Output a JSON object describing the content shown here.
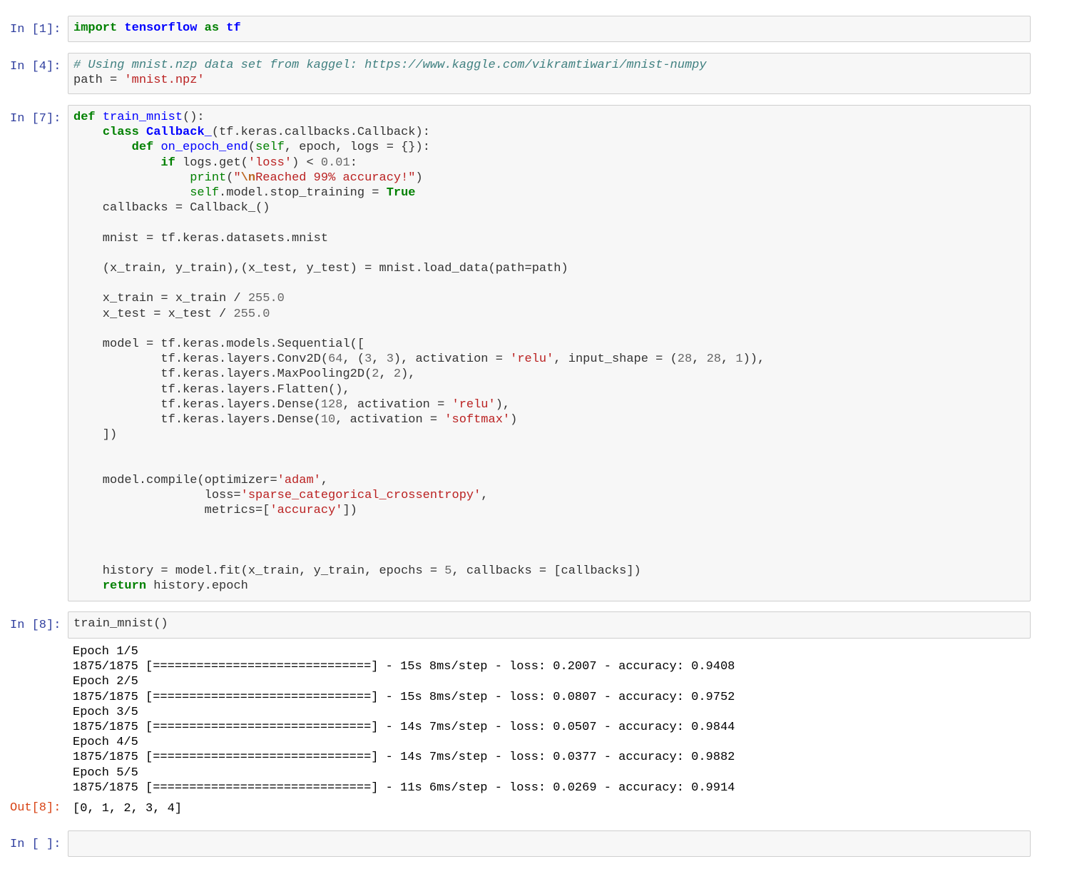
{
  "cells": [
    {
      "prompt": "In [1]:",
      "lines": [
        [
          [
            "kw",
            "import"
          ],
          [
            "",
            ""
          ],
          [
            "t",
            " "
          ],
          [
            "ns",
            "tensorflow"
          ],
          [
            "t",
            " "
          ],
          [
            "kw",
            "as"
          ],
          [
            "t",
            " "
          ],
          [
            "ns",
            "tf"
          ]
        ]
      ]
    },
    {
      "prompt": "In [4]:",
      "lines": [
        [
          [
            "cm",
            "# Using mnist.nzp data set from kaggel: https://www.kaggle.com/vikramtiwari/mnist-numpy"
          ]
        ],
        [
          [
            "t",
            "path = "
          ],
          [
            "st",
            "'mnist.npz'"
          ]
        ]
      ]
    },
    {
      "prompt": "In [7]:",
      "lines": [
        [
          [
            "kw",
            "def"
          ],
          [
            "t",
            " "
          ],
          [
            "fn",
            "train_mnist"
          ],
          [
            "t",
            "():"
          ]
        ],
        [
          [
            "t",
            "    "
          ],
          [
            "kw",
            "class"
          ],
          [
            "t",
            " "
          ],
          [
            "ns",
            "Callback_"
          ],
          [
            "t",
            "(tf.keras.callbacks.Callback):"
          ]
        ],
        [
          [
            "t",
            "        "
          ],
          [
            "kw",
            "def"
          ],
          [
            "t",
            " "
          ],
          [
            "fn",
            "on_epoch_end"
          ],
          [
            "t",
            "("
          ],
          [
            "nb",
            "self"
          ],
          [
            "t",
            ", epoch, logs = {}):"
          ]
        ],
        [
          [
            "t",
            "            "
          ],
          [
            "kw",
            "if"
          ],
          [
            "t",
            " logs.get("
          ],
          [
            "st",
            "'loss'"
          ],
          [
            "t",
            ") < "
          ],
          [
            "nm",
            "0.01"
          ],
          [
            "t",
            ":"
          ]
        ],
        [
          [
            "t",
            "                "
          ],
          [
            "nb",
            "print"
          ],
          [
            "t",
            "("
          ],
          [
            "st",
            "\""
          ],
          [
            "es",
            "\\n"
          ],
          [
            "st",
            "Reached 99% accuracy!\""
          ],
          [
            "t",
            ")"
          ]
        ],
        [
          [
            "t",
            "                "
          ],
          [
            "nb",
            "self"
          ],
          [
            "t",
            ".model.stop_training = "
          ],
          [
            "kw",
            "True"
          ]
        ],
        [
          [
            "t",
            "    callbacks = Callback_()"
          ]
        ],
        [],
        [
          [
            "t",
            "    mnist = tf.keras.datasets.mnist"
          ]
        ],
        [],
        [
          [
            "t",
            "    (x_train, y_train),(x_test, y_test) = mnist.load_data(path=path)"
          ]
        ],
        [],
        [
          [
            "t",
            "    x_train = x_train / "
          ],
          [
            "nm",
            "255.0"
          ]
        ],
        [
          [
            "t",
            "    x_test = x_test / "
          ],
          [
            "nm",
            "255.0"
          ]
        ],
        [],
        [
          [
            "t",
            "    model = tf.keras.models.Sequential(["
          ]
        ],
        [
          [
            "t",
            "            tf.keras.layers.Conv2D("
          ],
          [
            "nm",
            "64"
          ],
          [
            "t",
            ", ("
          ],
          [
            "nm",
            "3"
          ],
          [
            "t",
            ", "
          ],
          [
            "nm",
            "3"
          ],
          [
            "t",
            "), activation = "
          ],
          [
            "st",
            "'relu'"
          ],
          [
            "t",
            ", input_shape = ("
          ],
          [
            "nm",
            "28"
          ],
          [
            "t",
            ", "
          ],
          [
            "nm",
            "28"
          ],
          [
            "t",
            ", "
          ],
          [
            "nm",
            "1"
          ],
          [
            "t",
            ")),"
          ]
        ],
        [
          [
            "t",
            "            tf.keras.layers.MaxPooling2D("
          ],
          [
            "nm",
            "2"
          ],
          [
            "t",
            ", "
          ],
          [
            "nm",
            "2"
          ],
          [
            "t",
            "),"
          ]
        ],
        [
          [
            "t",
            "            tf.keras.layers.Flatten(),"
          ]
        ],
        [
          [
            "t",
            "            tf.keras.layers.Dense("
          ],
          [
            "nm",
            "128"
          ],
          [
            "t",
            ", activation = "
          ],
          [
            "st",
            "'relu'"
          ],
          [
            "t",
            "),"
          ]
        ],
        [
          [
            "t",
            "            tf.keras.layers.Dense("
          ],
          [
            "nm",
            "10"
          ],
          [
            "t",
            ", activation = "
          ],
          [
            "st",
            "'softmax'"
          ],
          [
            "t",
            ")"
          ]
        ],
        [
          [
            "t",
            "    ])"
          ]
        ],
        [],
        [],
        [
          [
            "t",
            "    model.compile(optimizer="
          ],
          [
            "st",
            "'adam'"
          ],
          [
            "t",
            ","
          ]
        ],
        [
          [
            "t",
            "                  loss="
          ],
          [
            "st",
            "'sparse_categorical_crossentropy'"
          ],
          [
            "t",
            ","
          ]
        ],
        [
          [
            "t",
            "                  metrics=["
          ],
          [
            "st",
            "'accuracy'"
          ],
          [
            "t",
            "])"
          ]
        ],
        [],
        [],
        [],
        [
          [
            "t",
            "    history = model.fit(x_train, y_train, epochs = "
          ],
          [
            "nm",
            "5"
          ],
          [
            "t",
            ", callbacks = [callbacks])"
          ]
        ],
        [
          [
            "t",
            "    "
          ],
          [
            "kw",
            "return"
          ],
          [
            "t",
            " history.epoch"
          ]
        ]
      ]
    },
    {
      "prompt": "In [8]:",
      "lines": [
        [
          [
            "t",
            "train_mnist()"
          ]
        ]
      ],
      "stdout": [
        "Epoch 1/5",
        "1875/1875 [==============================] - 15s 8ms/step - loss: 0.2007 - accuracy: 0.9408",
        "Epoch 2/5",
        "1875/1875 [==============================] - 15s 8ms/step - loss: 0.0807 - accuracy: 0.9752",
        "Epoch 3/5",
        "1875/1875 [==============================] - 14s 7ms/step - loss: 0.0507 - accuracy: 0.9844",
        "Epoch 4/5",
        "1875/1875 [==============================] - 14s 7ms/step - loss: 0.0377 - accuracy: 0.9882",
        "Epoch 5/5",
        "1875/1875 [==============================] - 11s 6ms/step - loss: 0.0269 - accuracy: 0.9914"
      ],
      "out_prompt": "Out[8]:",
      "out_value": "[0, 1, 2, 3, 4]"
    },
    {
      "prompt": "In [ ]:",
      "lines": []
    }
  ]
}
